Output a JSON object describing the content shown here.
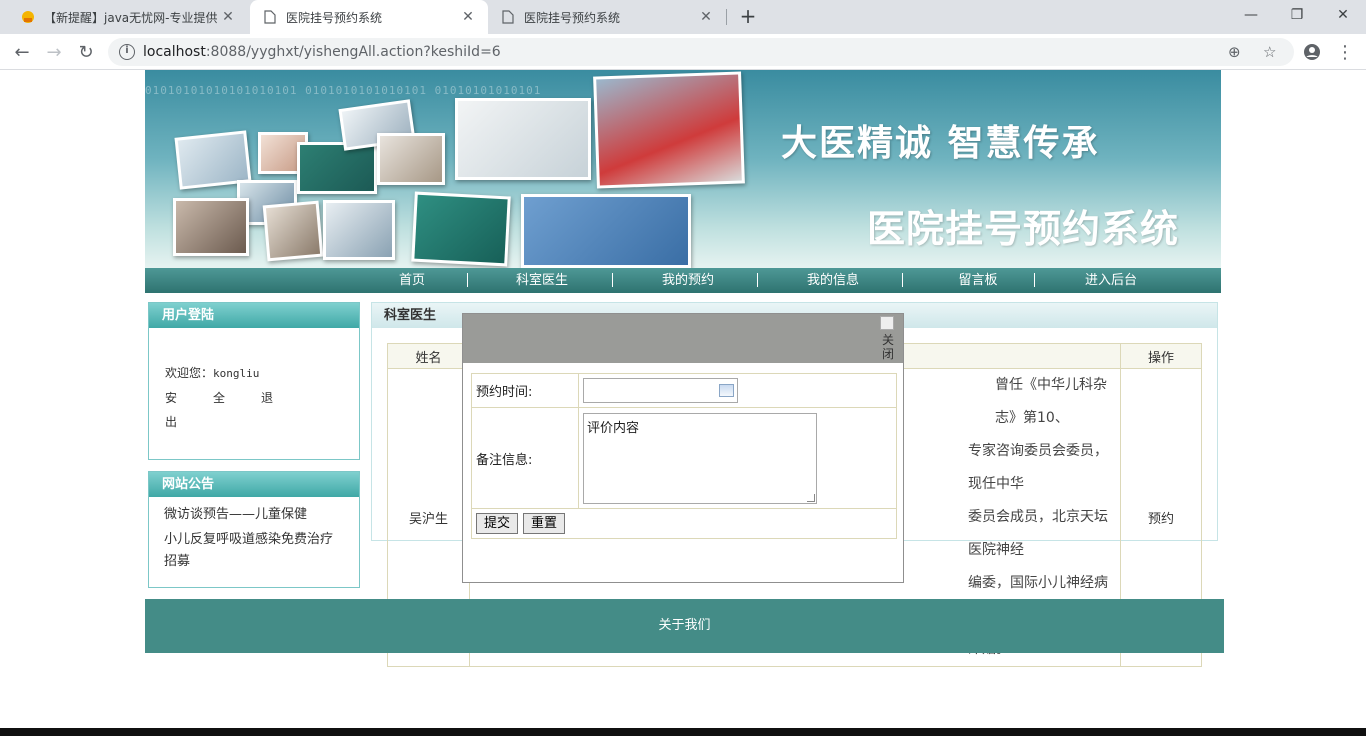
{
  "browser": {
    "tabs": [
      {
        "title": "【新提醒】java无忧网-专业提供"
      },
      {
        "title": "医院挂号预约系统"
      },
      {
        "title": "医院挂号预约系统"
      }
    ],
    "url_host": "localhost",
    "url_rest": ":8088/yyghxt/yishengAll.action?keshiId=6"
  },
  "banner": {
    "slogan": "大医精诚  智慧传承",
    "system_title": "医院挂号预约系统",
    "binary_text": "01010101010101010101  0101010101010101  01010101010101"
  },
  "menu": [
    "首页",
    "科室医生",
    "我的预约",
    "我的信息",
    "留言板",
    "进入后台"
  ],
  "login_box": {
    "title": "用户登陆",
    "welcome_label": "欢迎您：",
    "username": "kongliu",
    "logout": "安全退出"
  },
  "notice_box": {
    "title": "网站公告",
    "items": [
      "微访谈预告——儿童保健",
      "小儿反复呼吸道感染免费治疗",
      "招募"
    ]
  },
  "main": {
    "title": "科室医生",
    "columns": {
      "name": "姓名",
      "action": "操作"
    },
    "row": {
      "name": "吴沪生",
      "intro_lines": [
        "曾任《中华儿科杂志》第10、",
        "专家咨询委员会委员，现任中华",
        "委员会成员，北京天坛医院神经",
        "编委，国际小儿神经病学会员。",
        "津贴。"
      ],
      "action": "预约"
    }
  },
  "footer": {
    "text": "关于我们"
  },
  "modal": {
    "close_alt": "关闭",
    "time_label": "预约时间:",
    "time_value": "",
    "remark_label": "备注信息:",
    "remark_value": "评价内容",
    "submit": "提交",
    "reset": "重置"
  }
}
